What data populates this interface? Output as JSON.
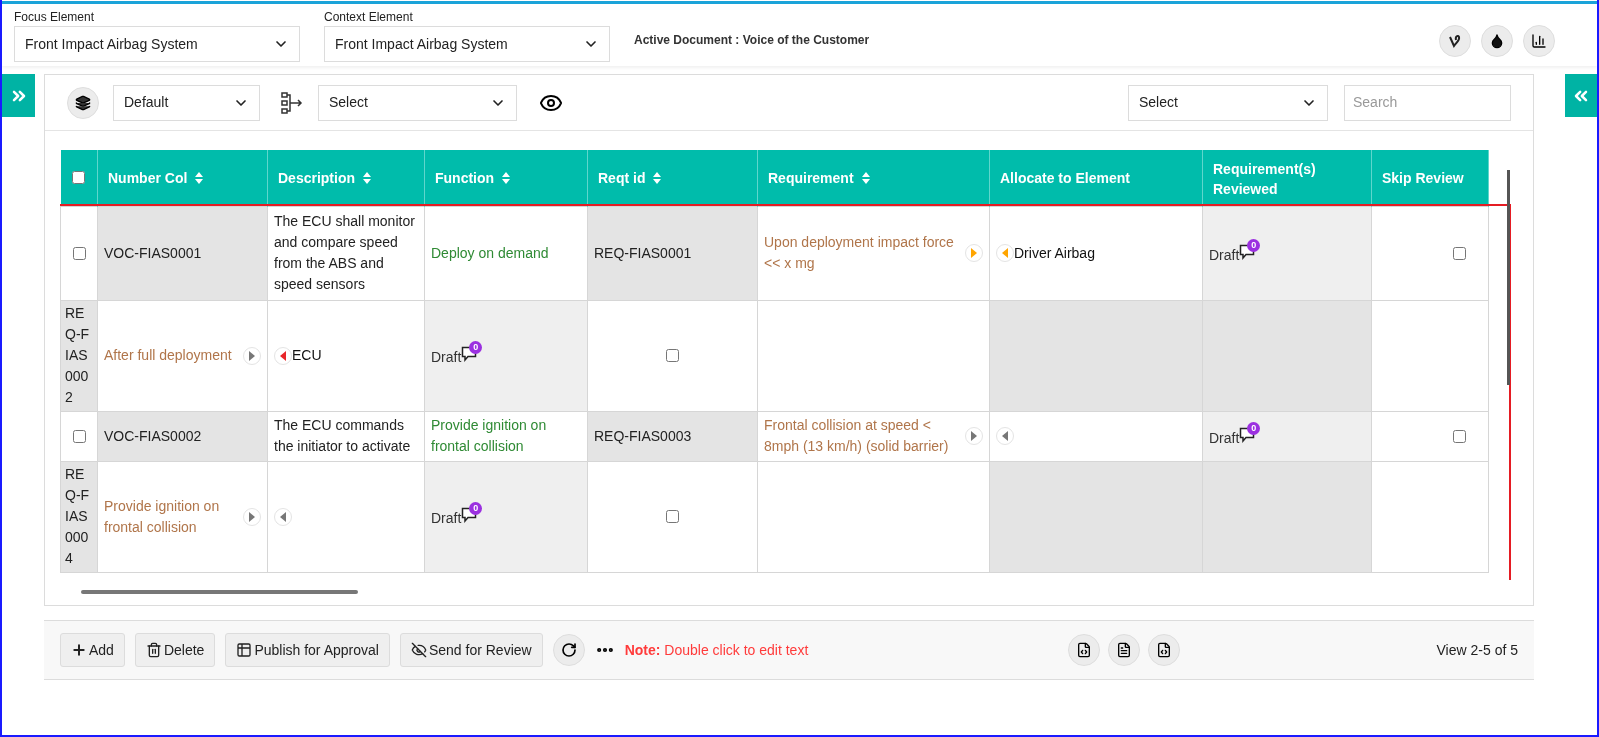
{
  "header": {
    "focus": {
      "label": "Focus Element",
      "value": "Front Impact Airbag System"
    },
    "context": {
      "label": "Context Element",
      "value": "Front Impact Airbag System"
    },
    "active_document": "Active Document : Voice of the Customer"
  },
  "toolbar": {
    "view_select": "Default",
    "filter_select": "Select",
    "column_select": "Select",
    "search": {
      "placeholder": "Search"
    }
  },
  "table": {
    "select_all": {
      "checked": false
    },
    "columns": [
      {
        "label": "Number Col",
        "sortable": true
      },
      {
        "label": "Description",
        "sortable": true
      },
      {
        "label": "Function",
        "sortable": true
      },
      {
        "label": "Reqt id",
        "sortable": true
      },
      {
        "label": "Requirement",
        "sortable": true
      },
      {
        "label": "Allocate to Element",
        "sortable": false
      },
      {
        "label": "Requirement(s) Reviewed",
        "sortable": false
      },
      {
        "label": "Skip Review",
        "sortable": false
      }
    ],
    "rows": [
      {
        "kind": "voc",
        "checked": false,
        "number": "VOC-FIAS0001",
        "description": "The ECU shall monitor and compare speed from the ABS and speed sensors",
        "function": "Deploy on demand",
        "reqt_id": "REQ-FIAS0001",
        "requirement": {
          "text": "Upon deployment impact force << x mg",
          "color": "#ffa500"
        },
        "allocate": {
          "text": "Driver Airbag",
          "color": "#ffa500"
        },
        "status": "Draft",
        "comments": "0",
        "skip": false
      },
      {
        "kind": "req",
        "id": "REQ-FIAS0002",
        "requirement": {
          "text": "After full deployment",
          "color": "#777777"
        },
        "allocate": {
          "text": "ECU",
          "color": "#e8262a"
        },
        "status": "Draft",
        "comments": "0",
        "checked": false
      },
      {
        "kind": "voc",
        "checked": false,
        "number": "VOC-FIAS0002",
        "description": "The ECU commands the initiator to activate",
        "function": "Provide ignition on frontal collision",
        "reqt_id": "REQ-FIAS0003",
        "requirement": {
          "text": "Frontal collision at speed < 8mph (13 km/h) (solid barrier)",
          "color": "#777777"
        },
        "allocate": {
          "color": "#777777"
        },
        "status": "Draft",
        "comments": "0",
        "skip": false
      },
      {
        "kind": "req",
        "id": "REQ-FIAS0004",
        "requirement": {
          "text": "Provide ignition on frontal collision",
          "color": "#777777"
        },
        "allocate": {
          "color": "#777777"
        },
        "status": "Draft",
        "comments": "0",
        "checked": false
      }
    ]
  },
  "footer": {
    "buttons": [
      {
        "label": "Add"
      },
      {
        "label": "Delete"
      },
      {
        "label": "Publish for Approval"
      },
      {
        "label": "Send for Review"
      }
    ],
    "note_label": "Note:",
    "note": "Double click to edit text",
    "pager": "View 2-5 of 5"
  }
}
